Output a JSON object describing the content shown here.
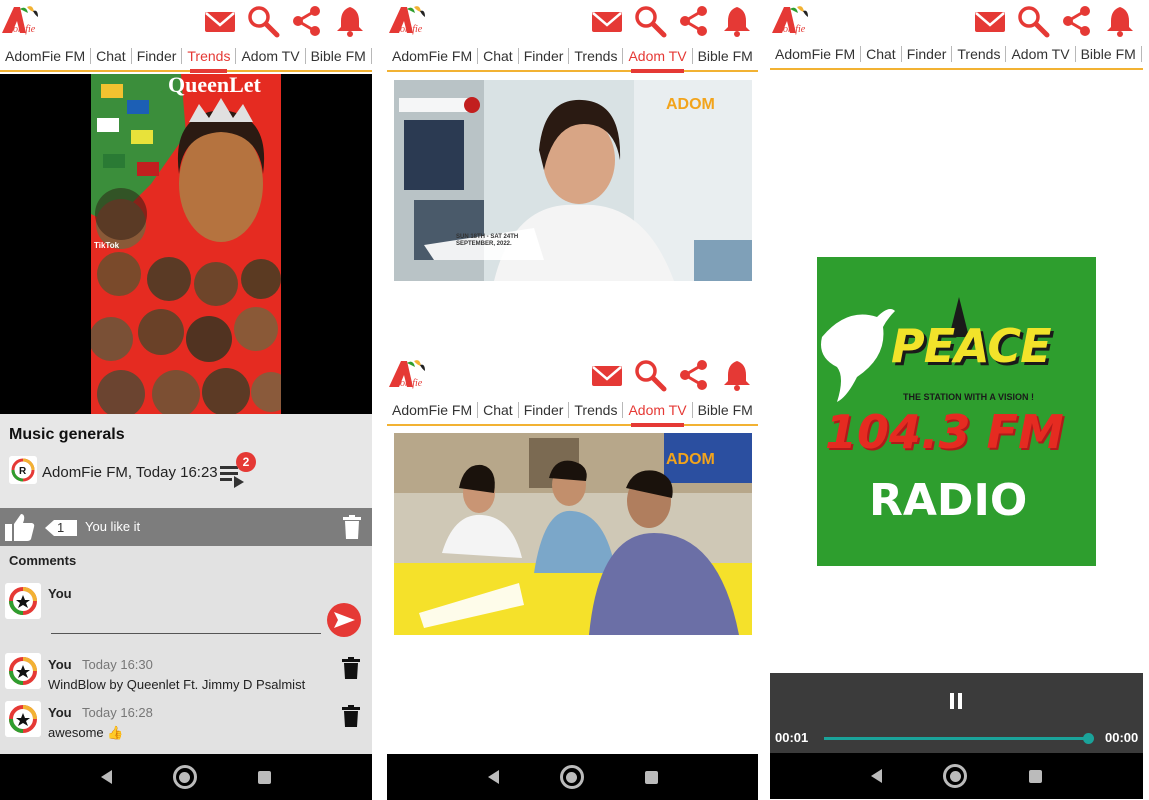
{
  "tabs": [
    "AdomFie FM",
    "Chat",
    "Finder",
    "Trends",
    "Adom TV",
    "Bible FM"
  ],
  "logo_text": "domfie",
  "screen1": {
    "active_tab": "Trends",
    "poster_title": "QueenLet",
    "poster_tag": "TikTok",
    "post": {
      "title": "Music generals",
      "meta": "AdomFie FM, Today 16:23",
      "playlist_badge": "2"
    },
    "like": {
      "count": "1",
      "label": "You like it"
    },
    "comments_heading": "Comments",
    "composer_name": "You",
    "comments": [
      {
        "name": "You",
        "time": "Today 16:30",
        "text": "WindBlow by Queenlet Ft. Jimmy D Psalmist"
      },
      {
        "name": "You",
        "time": "Today 16:28",
        "text": "awesome 👍"
      }
    ]
  },
  "screen2": {
    "active_tab": "Adom TV",
    "watermark": "ADOM",
    "video1_banner": "SUN 18TH - SAT 24TH SEPTEMBER, 2022.",
    "video2_watermark": "ADOM"
  },
  "screen3": {
    "logo_word": "PEACE",
    "logo_tagline": "THE STATION WITH A VISION !",
    "logo_freq": "104.3 FM",
    "logo_radio": "RADIO",
    "elapsed": "00:01",
    "duration": "00:00",
    "progress": 1.0
  },
  "colors": {
    "accent": "#e53935",
    "tab_underline": "#f2b233",
    "peace_green": "#2e9e2e",
    "player_bg": "#3b3b3b",
    "seek": "#1aa39a"
  }
}
